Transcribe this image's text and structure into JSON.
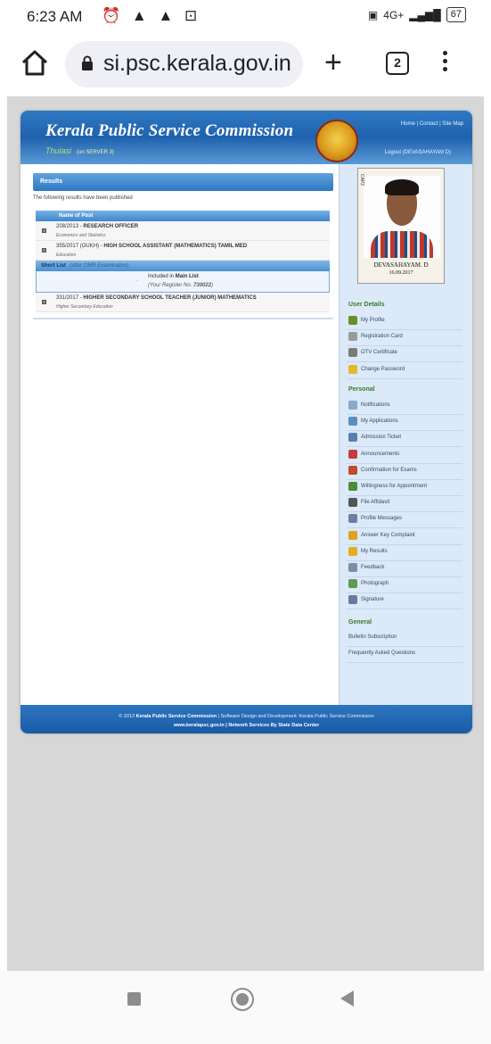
{
  "status": {
    "time": "6:23 AM",
    "network": "4G+",
    "battery": "67"
  },
  "browser": {
    "url": "si.psc.kerala.gov.in",
    "tab_count": "2"
  },
  "site": {
    "title": "Kerala Public Service Commission",
    "thulasi": "Thulasi",
    "server": "(on SERVER 3)",
    "toplinks": "Home | Contact | Site Map",
    "logout": "Logout (DEVASAHAYAM D)"
  },
  "main": {
    "results_title": "Results",
    "intro": "The following results have been published",
    "table_header": "Name of Post",
    "rows": [
      {
        "code": "208/2013",
        "post": "RESEARCH OFFICER",
        "dept": "Economics and Statistics"
      },
      {
        "code": "355/2017 (OUKH)",
        "post": "HIGH SCHOOL ASSISTANT (MATHEMATICS) TAMIL MED",
        "dept": "Education"
      }
    ],
    "shortlist": {
      "label": "Short List",
      "note": "(after OMR Examination)",
      "included_prefix": "Included in",
      "included_list": "Main List",
      "register_prefix": "(Your Register No.",
      "register_no": "730022",
      "register_suffix": ")"
    },
    "row3": {
      "code": "331/2017",
      "post": "HIGHER SECONDARY SCHOOL TEACHER (JUNIOR) MATHEMATICS",
      "dept": "Higher Secondary Education"
    }
  },
  "sidebar": {
    "photo_caption": "CAP2",
    "name": "DEVASAHAYAM. D",
    "photo_date": "16.09.2017",
    "user_details_title": "User Details",
    "user_details": [
      "My Profile",
      "Registration Card",
      "OTV Certificate",
      "Change Password"
    ],
    "personal_title": "Personal",
    "personal": [
      "Notifications",
      "My Applications",
      "Admission Ticket",
      "Announcements",
      "Confirmation for Exams",
      "Willingness for Appointment",
      "File Affidavit",
      "Profile Messages",
      "Answer Key Complaint",
      "My Results",
      "Feedback",
      "Photograph",
      "Signature"
    ],
    "general_title": "General",
    "general": [
      "Bulletin Subscription",
      "Frequently Asked Questions"
    ]
  },
  "footer": {
    "line1_prefix": "© 2013",
    "line1_org": "Kerala Public Service Commission",
    "line1_rest": "| Software Design and Development: Kerala Public Service Commission",
    "line2": "www.keralapsc.gov.in | Network Services By State Data Center"
  },
  "colors": {
    "header_blue": "#1f62ad",
    "sidebar_bg": "#dbe9f8",
    "section_green": "#3a7a2e"
  }
}
